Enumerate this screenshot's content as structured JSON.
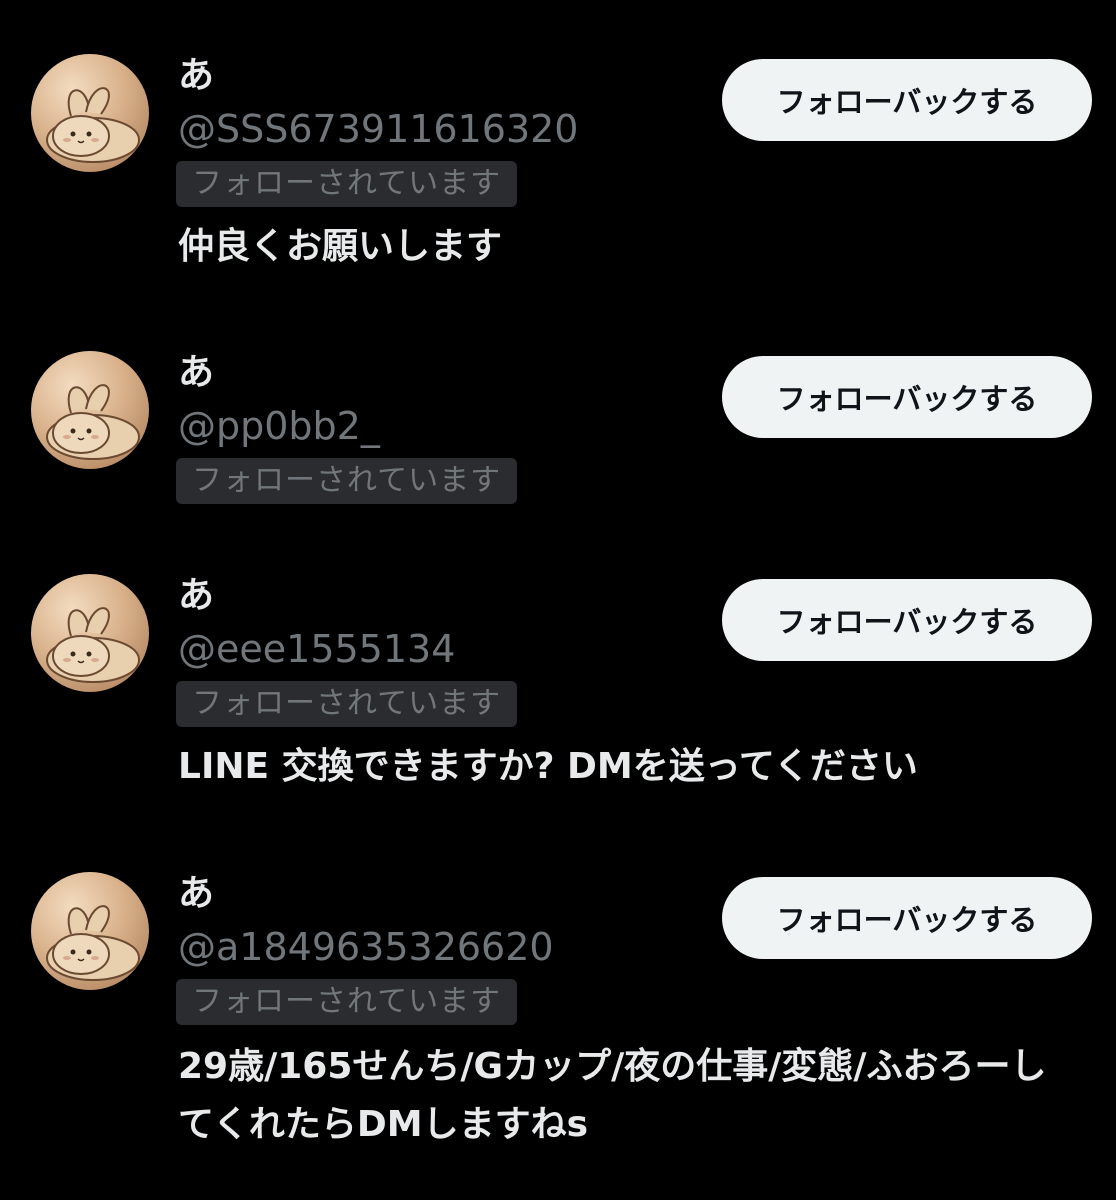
{
  "follower_list": {
    "users": [
      {
        "display_name": "あ",
        "handle": "@SSS673911616320",
        "badge": "フォローされています",
        "button_label": "フォローバックする",
        "bio": "仲良くお願いします",
        "avatar_icon": "bunny-avatar-icon"
      },
      {
        "display_name": "あ",
        "handle": "@pp0bb2_",
        "badge": "フォローされています",
        "button_label": "フォローバックする",
        "bio": "",
        "avatar_icon": "bunny-avatar-icon"
      },
      {
        "display_name": "あ",
        "handle": "@eee1555134",
        "badge": "フォローされています",
        "button_label": "フォローバックする",
        "bio": "LINE 交換できますか? DMを送ってください",
        "avatar_icon": "bunny-avatar-icon"
      },
      {
        "display_name": "あ",
        "handle": "@a1849635326620",
        "badge": "フォローされています",
        "button_label": "フォローバックする",
        "bio": "29歳/165せんち/Gカップ/夜の仕事/変態/ふおろーしてくれたらDMしますねs",
        "avatar_icon": "bunny-avatar-icon"
      }
    ]
  },
  "colors": {
    "background": "#000000",
    "primary_text": "#e7e9ea",
    "secondary_text": "#71767b",
    "badge_background": "#2a2c30",
    "button_background": "#eff3f4",
    "button_text": "#0f1419"
  }
}
